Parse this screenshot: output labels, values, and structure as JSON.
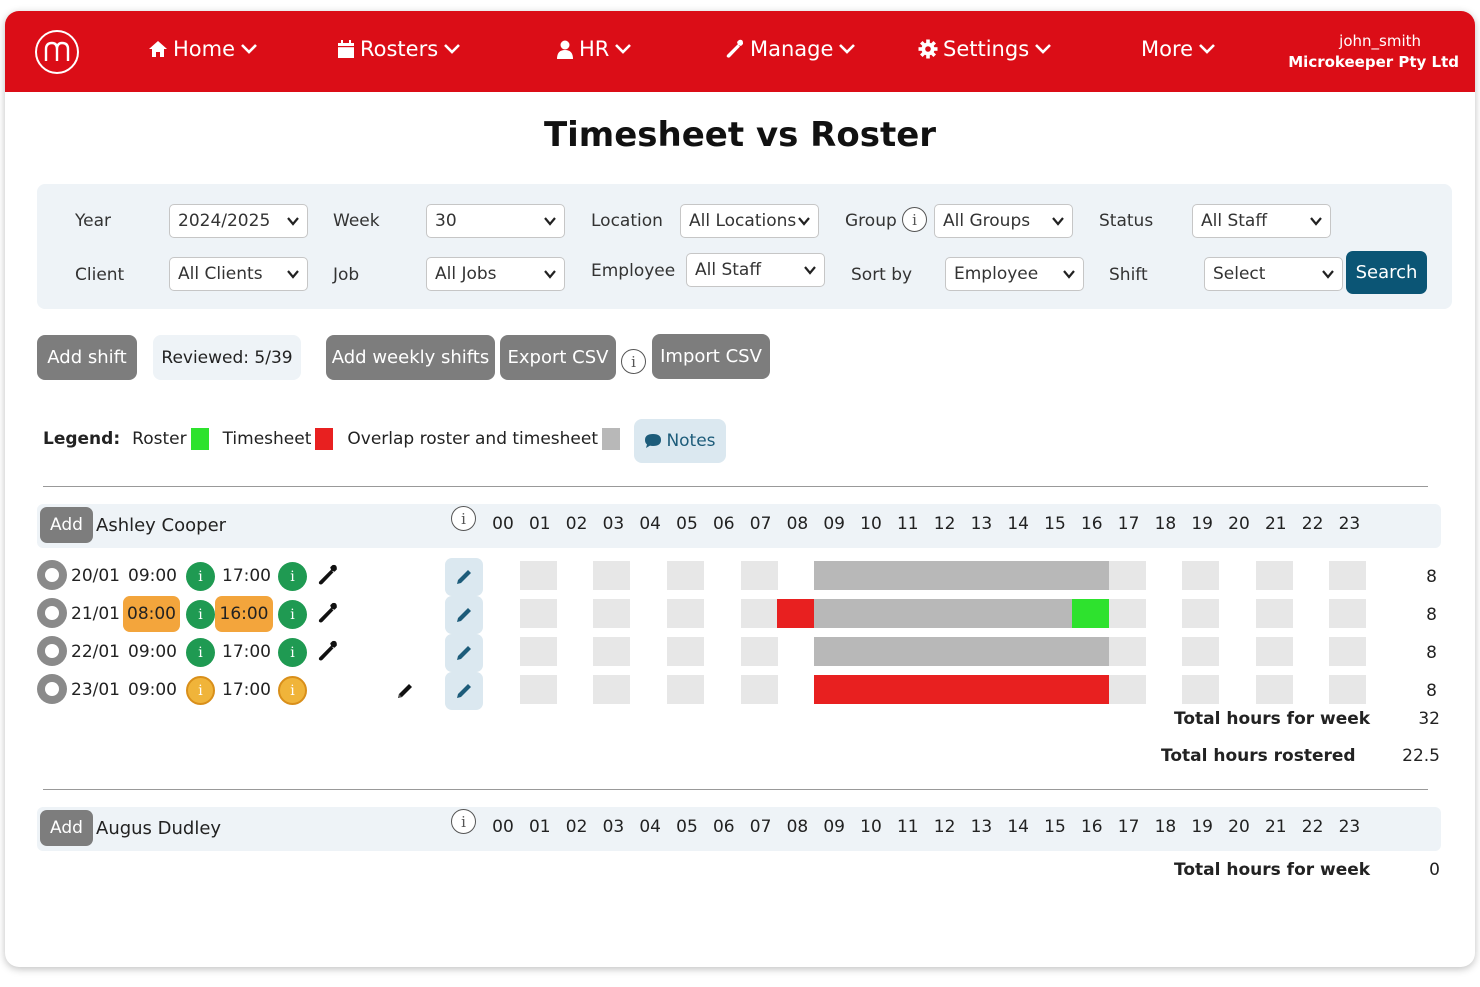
{
  "nav": {
    "logo_letter": "m",
    "items": [
      {
        "label": "Home",
        "icon": "home-icon"
      },
      {
        "label": "Rosters",
        "icon": "calendar-icon"
      },
      {
        "label": "HR",
        "icon": "user-icon"
      },
      {
        "label": "Manage",
        "icon": "wrench-icon"
      },
      {
        "label": "Settings",
        "icon": "gear-icon"
      },
      {
        "label": "More",
        "icon": ""
      }
    ],
    "username": "john_smith",
    "company": "Microkeeper Pty Ltd"
  },
  "page_title": "Timesheet vs Roster",
  "filters": {
    "year": {
      "label": "Year",
      "value": "2024/2025"
    },
    "week": {
      "label": "Week",
      "value": "30"
    },
    "location": {
      "label": "Location",
      "value": "All Locations"
    },
    "group": {
      "label": "Group",
      "value": "All Groups"
    },
    "status": {
      "label": "Status",
      "value": "All Staff"
    },
    "client": {
      "label": "Client",
      "value": "All Clients"
    },
    "job": {
      "label": "Job",
      "value": "All Jobs"
    },
    "employee": {
      "label": "Employee",
      "value": "All Staff"
    },
    "sortby": {
      "label": "Sort by",
      "value": "Employee"
    },
    "shift": {
      "label": "Shift",
      "value": "Select"
    },
    "search_label": "Search"
  },
  "actions": {
    "add_shift": "Add shift",
    "reviewed": "Reviewed: 5/39",
    "add_weekly": "Add weekly shifts",
    "export_csv": "Export CSV",
    "import_csv": "Import CSV"
  },
  "legend": {
    "title": "Legend:",
    "roster": "Roster",
    "timesheet": "Timesheet",
    "overlap": "Overlap roster and timesheet",
    "notes": "Notes",
    "colors": {
      "roster": "#2ee22e",
      "timesheet": "#e82020",
      "overlap": "#b8b8b8"
    }
  },
  "hours": [
    "00",
    "01",
    "02",
    "03",
    "04",
    "05",
    "06",
    "07",
    "08",
    "09",
    "10",
    "11",
    "12",
    "13",
    "14",
    "15",
    "16",
    "17",
    "18",
    "19",
    "20",
    "21",
    "22",
    "23"
  ],
  "employees": [
    {
      "add_label": "Add",
      "name": "Ashley Cooper",
      "shifts": [
        {
          "date": "20/01",
          "start": "09:00",
          "end": "17:00",
          "start_flag": false,
          "end_flag": false,
          "status": "green",
          "wrench": true,
          "pencil": false,
          "total": "8",
          "segments": [
            {
              "from": 9,
              "to": 17,
              "type": "overlap"
            }
          ]
        },
        {
          "date": "21/01",
          "start": "08:00",
          "end": "16:00",
          "start_flag": true,
          "end_flag": true,
          "status": "green",
          "wrench": true,
          "pencil": false,
          "total": "8",
          "segments": [
            {
              "from": 8,
              "to": 9,
              "type": "timesheet"
            },
            {
              "from": 9,
              "to": 16,
              "type": "overlap"
            },
            {
              "from": 16,
              "to": 17,
              "type": "roster"
            }
          ]
        },
        {
          "date": "22/01",
          "start": "09:00",
          "end": "17:00",
          "start_flag": false,
          "end_flag": false,
          "status": "green",
          "wrench": true,
          "pencil": false,
          "total": "8",
          "segments": [
            {
              "from": 9,
              "to": 17,
              "type": "overlap"
            }
          ]
        },
        {
          "date": "23/01",
          "start": "09:00",
          "end": "17:00",
          "start_flag": false,
          "end_flag": false,
          "status": "orange",
          "wrench": false,
          "pencil": true,
          "total": "8",
          "segments": [
            {
              "from": 9,
              "to": 17,
              "type": "timesheet"
            }
          ]
        }
      ],
      "total_week_label": "Total hours for week",
      "total_week": "32",
      "total_rostered_label": "Total hours rostered",
      "total_rostered": "22.5"
    },
    {
      "add_label": "Add",
      "name": "Augus Dudley",
      "shifts": [],
      "total_week_label": "Total hours for week",
      "total_week": "0"
    }
  ]
}
